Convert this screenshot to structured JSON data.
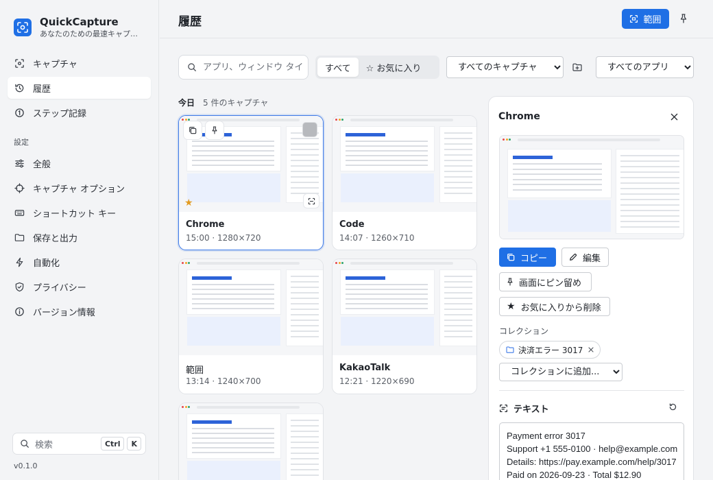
{
  "app": {
    "name": "QuickCapture",
    "tagline": "あなたのための最速キャプ…"
  },
  "nav": {
    "items": [
      {
        "label": "キャプチャ",
        "icon": "capture-icon"
      },
      {
        "label": "履歴",
        "icon": "history-icon",
        "active": true
      },
      {
        "label": "ステップ記録",
        "icon": "steps-icon"
      }
    ],
    "settings_label": "設定",
    "settings": [
      {
        "label": "全般",
        "icon": "sliders-icon"
      },
      {
        "label": "キャプチャ オプション",
        "icon": "crosshair-icon"
      },
      {
        "label": "ショートカット キー",
        "icon": "keyboard-icon"
      },
      {
        "label": "保存と出力",
        "icon": "folder-icon"
      },
      {
        "label": "自動化",
        "icon": "bolt-icon"
      },
      {
        "label": "プライバシー",
        "icon": "shield-icon"
      },
      {
        "label": "バージョン情報",
        "icon": "info-icon"
      }
    ]
  },
  "sidebar_search": {
    "label": "検索",
    "keys": [
      "Ctrl",
      "K"
    ]
  },
  "version": "v0.1.0",
  "header": {
    "title": "履歴",
    "range_button": "範囲"
  },
  "filters": {
    "search_placeholder": "アプリ、ウィンドウ タイ",
    "segments": [
      "すべて",
      "☆ お気に入り"
    ],
    "capture_select": "すべてのキャプチャ",
    "app_select": "すべてのアプリ"
  },
  "group": {
    "day": "今日",
    "count": "5 件のキャプチャ"
  },
  "captures": [
    {
      "title": "Chrome",
      "meta": "15:00 · 1280×720",
      "selected": true,
      "favorite": true
    },
    {
      "title": "Code",
      "meta": "14:07 · 1260×710"
    },
    {
      "title": "範囲",
      "meta": "13:14 · 1240×700"
    },
    {
      "title": "KakaoTalk",
      "meta": "12:21 · 1220×690"
    },
    {
      "title": "",
      "meta": ""
    }
  ],
  "detail": {
    "title": "Chrome",
    "copy": "コピー",
    "edit": "編集",
    "pin": "画面にピン留め",
    "unfavorite": "お気に入りから削除",
    "collection_label": "コレクション",
    "collection_chip": "決済エラー 3017",
    "add_collection": "コレクションに追加...",
    "text_title": "テキスト",
    "text_lines": [
      "Payment error 3017",
      "Support +1 555-0100 · help@example.com",
      "Details: https://pay.example.com/help/3017",
      "Paid on 2026-09-23 · Total $12.90"
    ]
  },
  "colors": {
    "accent": "#1f6fe5",
    "star": "#e39b21"
  }
}
